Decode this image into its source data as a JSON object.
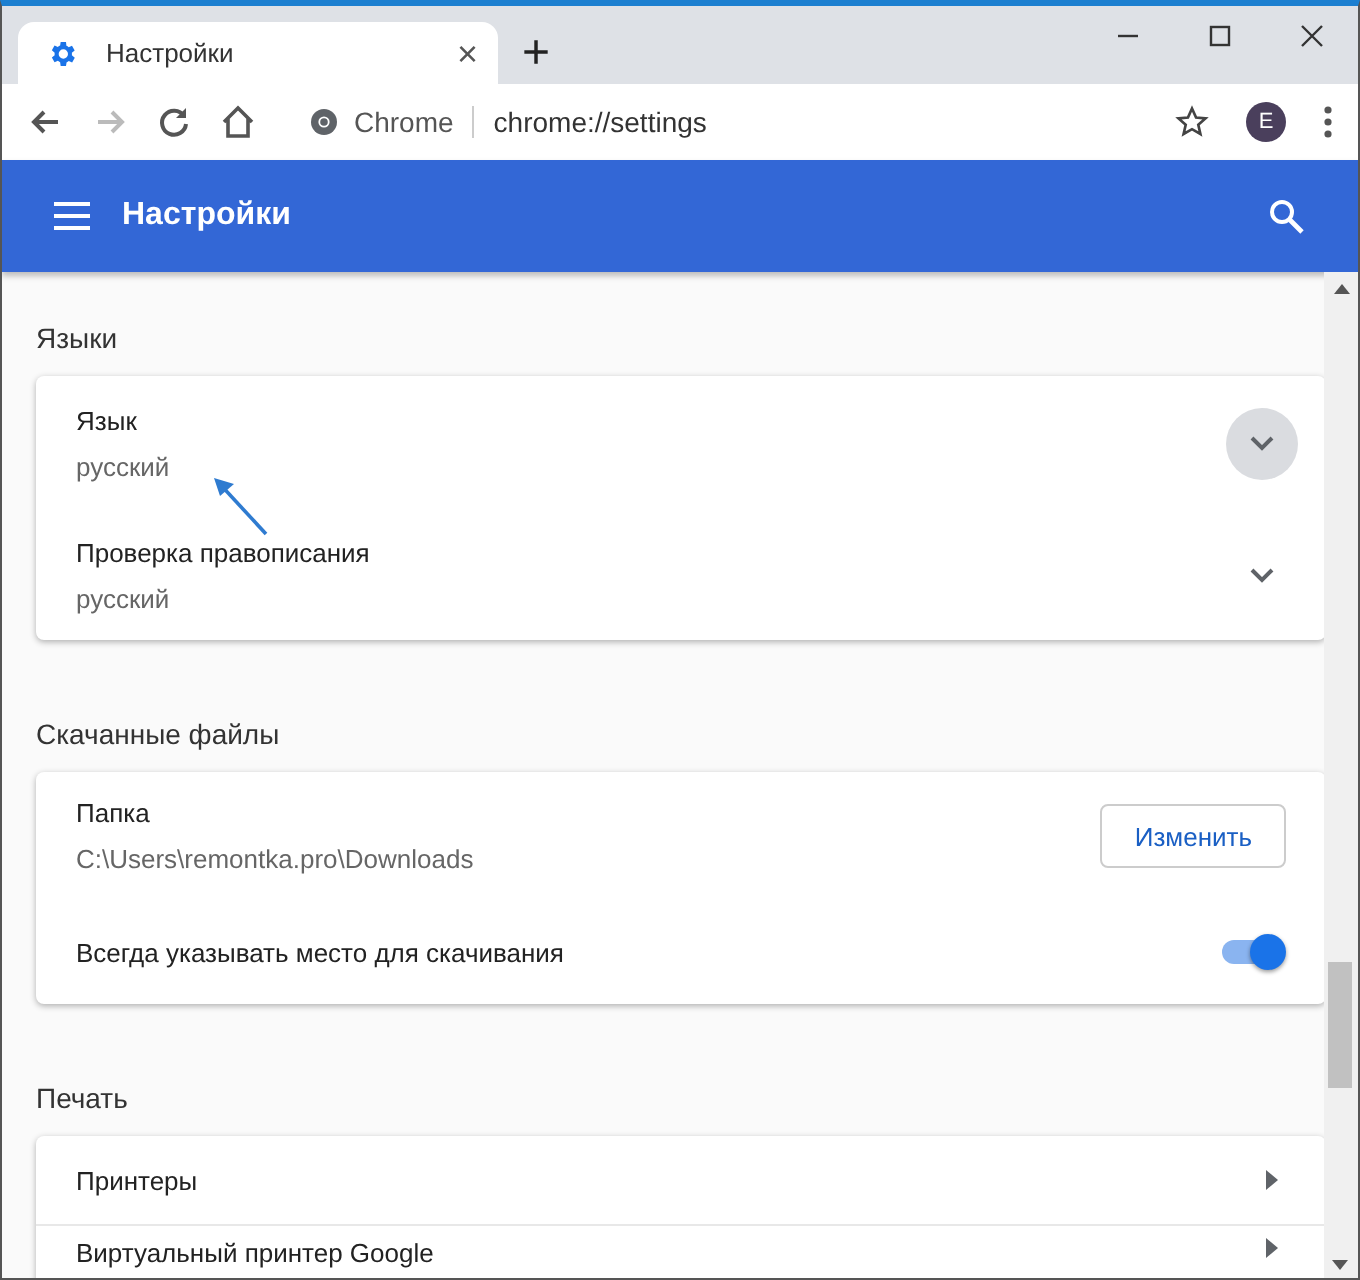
{
  "tab": {
    "title": "Настройки",
    "close": "×"
  },
  "new_tab": "+",
  "toolbar": {
    "site": "Chrome",
    "url": "chrome://settings",
    "profile": "E"
  },
  "header": {
    "title": "Настройки"
  },
  "sections": [
    {
      "title": "Языки",
      "rows": [
        {
          "kind": "expand",
          "label": "Язык",
          "value": "русский",
          "highlighted": true
        },
        {
          "kind": "expand",
          "label": "Проверка правописания",
          "value": "русский",
          "highlighted": false
        }
      ]
    },
    {
      "title": "Скачанные файлы",
      "rows": [
        {
          "kind": "button",
          "label": "Папка",
          "value": "C:\\Users\\remontka.pro\\Downloads",
          "button": "Изменить"
        },
        {
          "kind": "toggle",
          "label": "Всегда указывать место для скачивания",
          "on": true
        }
      ]
    },
    {
      "title": "Печать",
      "rows": [
        {
          "kind": "link",
          "label": "Принтеры"
        },
        {
          "kind": "link",
          "label": "Виртуальный принтер Google"
        }
      ]
    }
  ]
}
